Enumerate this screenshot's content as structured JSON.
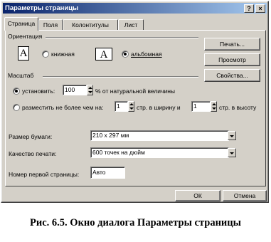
{
  "window": {
    "title": "Параметры страницы",
    "help_glyph": "?",
    "close_glyph": "×"
  },
  "tabs": [
    "Страница",
    "Поля",
    "Колонтитулы",
    "Лист"
  ],
  "orientation": {
    "group_label": "Ориентация",
    "page_glyph": "A",
    "portrait_label": "книжная",
    "landscape_label": "альбомная",
    "selected": "landscape"
  },
  "side_buttons": {
    "print": "Печать...",
    "preview": "Просмотр",
    "properties": "Свойства..."
  },
  "scale": {
    "group_label": "Масштаб",
    "set_label": "установить:",
    "set_value": "100",
    "set_suffix": "% от натуральной величины",
    "fit_label": "разместить не более чем на:",
    "fit_wide_value": "1",
    "fit_wide_suffix": "стр. в ширину и",
    "fit_tall_value": "1",
    "fit_tall_suffix": "стр. в высоту",
    "selected": "set"
  },
  "paper": {
    "size_label": "Размер бумаги:",
    "size_value": "210 x 297 мм"
  },
  "quality": {
    "label": "Качество печати:",
    "value": "600 точек на дюйм"
  },
  "first_page": {
    "label": "Номер первой страницы:",
    "value": "Авто"
  },
  "footer": {
    "ok": "ОК",
    "cancel": "Отмена"
  },
  "caption": "Рис. 6.5. Окно диалога Параметры страницы"
}
